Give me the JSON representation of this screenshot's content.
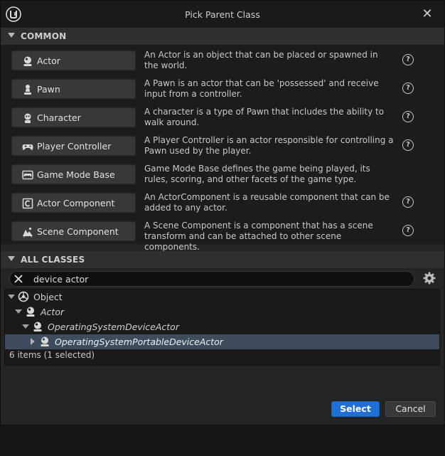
{
  "window": {
    "title": "Pick Parent Class",
    "close_glyph": "✕"
  },
  "common": {
    "header": "COMMON",
    "items": [
      {
        "label": "Actor",
        "icon": "actor-icon",
        "description": "An Actor is an object that can be placed or spawned in the world.",
        "help": "?"
      },
      {
        "label": "Pawn",
        "icon": "pawn-icon",
        "description": "A Pawn is an actor that can be 'possessed' and receive input from a controller.",
        "help": "?"
      },
      {
        "label": "Character",
        "icon": "character-icon",
        "description": "A character is a type of Pawn that includes the ability to walk around.",
        "help": "?"
      },
      {
        "label": "Player Controller",
        "icon": "gamepad-icon",
        "description": "A Player Controller is an actor responsible for controlling a Pawn used by the player.",
        "help": "?"
      },
      {
        "label": "Game Mode Base",
        "icon": "game-mode-icon",
        "description": "Game Mode Base defines the game being played, its rules, scoring, and other facets of the game type.",
        "help": ""
      },
      {
        "label": "Actor Component",
        "icon": "component-icon",
        "description": "An ActorComponent is a reusable component that can be added to any actor.",
        "help": "?"
      },
      {
        "label": "Scene Component",
        "icon": "scene-component-icon",
        "description": "A Scene Component is a component that has a scene transform and can be attached to other scene components.",
        "help": "?"
      }
    ]
  },
  "all_classes": {
    "header": "ALL CLASSES",
    "search": {
      "value": "device actor",
      "placeholder": ""
    },
    "tree": [
      {
        "label": "Object",
        "icon": "object-icon",
        "italic": false,
        "expanded": true,
        "selected": false
      },
      {
        "label": "Actor",
        "icon": "actor-icon",
        "italic": true,
        "expanded": true,
        "selected": false
      },
      {
        "label": "OperatingSystemDeviceActor",
        "icon": "actor-icon",
        "italic": true,
        "expanded": true,
        "selected": false
      },
      {
        "label": "OperatingSystemPortableDeviceActor",
        "icon": "actor-icon",
        "italic": true,
        "expanded": false,
        "selected": true
      }
    ],
    "status": "6 items (1 selected)"
  },
  "footer": {
    "select_label": "Select",
    "cancel_label": "Cancel"
  },
  "colors": {
    "accent": "#1f6fd6",
    "selection": "#3d4b5c"
  }
}
